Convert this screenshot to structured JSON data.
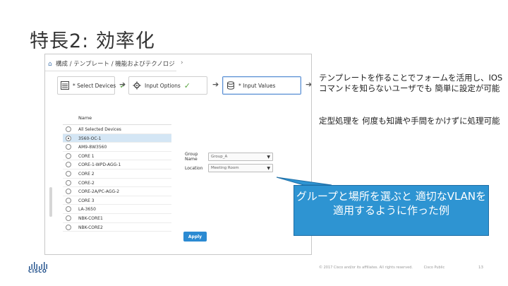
{
  "slide": {
    "title": "特長2: 効率化",
    "notes": [
      "テンプレートを作ることでフォームを活用し、IOSコマンドを知らないユーザでも 簡単に設定が可能",
      "定型処理を 何度も知識や手間をかけずに処理可能"
    ],
    "callout": "グループと場所を選ぶと 適切なVLANを適用するように作った例"
  },
  "screenshot": {
    "breadcrumb": "構成 / テンプレート / 機能およびテクノロジ",
    "overflow": "›",
    "steps": [
      {
        "label": "* Select Devices",
        "icon": "list-icon",
        "complete": true
      },
      {
        "label": "Input Options",
        "icon": "gear-icon",
        "complete": true
      },
      {
        "label": "* Input Values",
        "icon": "database-icon",
        "complete": false
      }
    ],
    "table": {
      "header": "Name",
      "rows": [
        "All Selected Devices",
        "3560-OC-1",
        "AM9-8W3560",
        "CORE 1",
        "CORE-1-WPD-AGG-1",
        "CORE 2",
        "CORE-2",
        "CORE-2A/PC-AGG-2",
        "CORE 3",
        "LA-3650",
        "NBK-CORE1",
        "NBK-CORE2"
      ],
      "selected_index": 1
    },
    "form": {
      "group_name_label": "Group Name",
      "group_name_value": "Group_A",
      "location_label": "Location",
      "location_value": "Meeting Room"
    },
    "apply_label": "Apply"
  },
  "footer": {
    "logo_text": "CISCO",
    "copyright": "© 2017  Cisco and/or its affiliates. All rights reserved.",
    "classification": "Cisco Public",
    "page": "13"
  },
  "colors": {
    "callout_bg": "#2e94d2",
    "apply_bg": "#2b8ad2",
    "selected_row": "#d4e6f5",
    "check": "#5aa642"
  }
}
